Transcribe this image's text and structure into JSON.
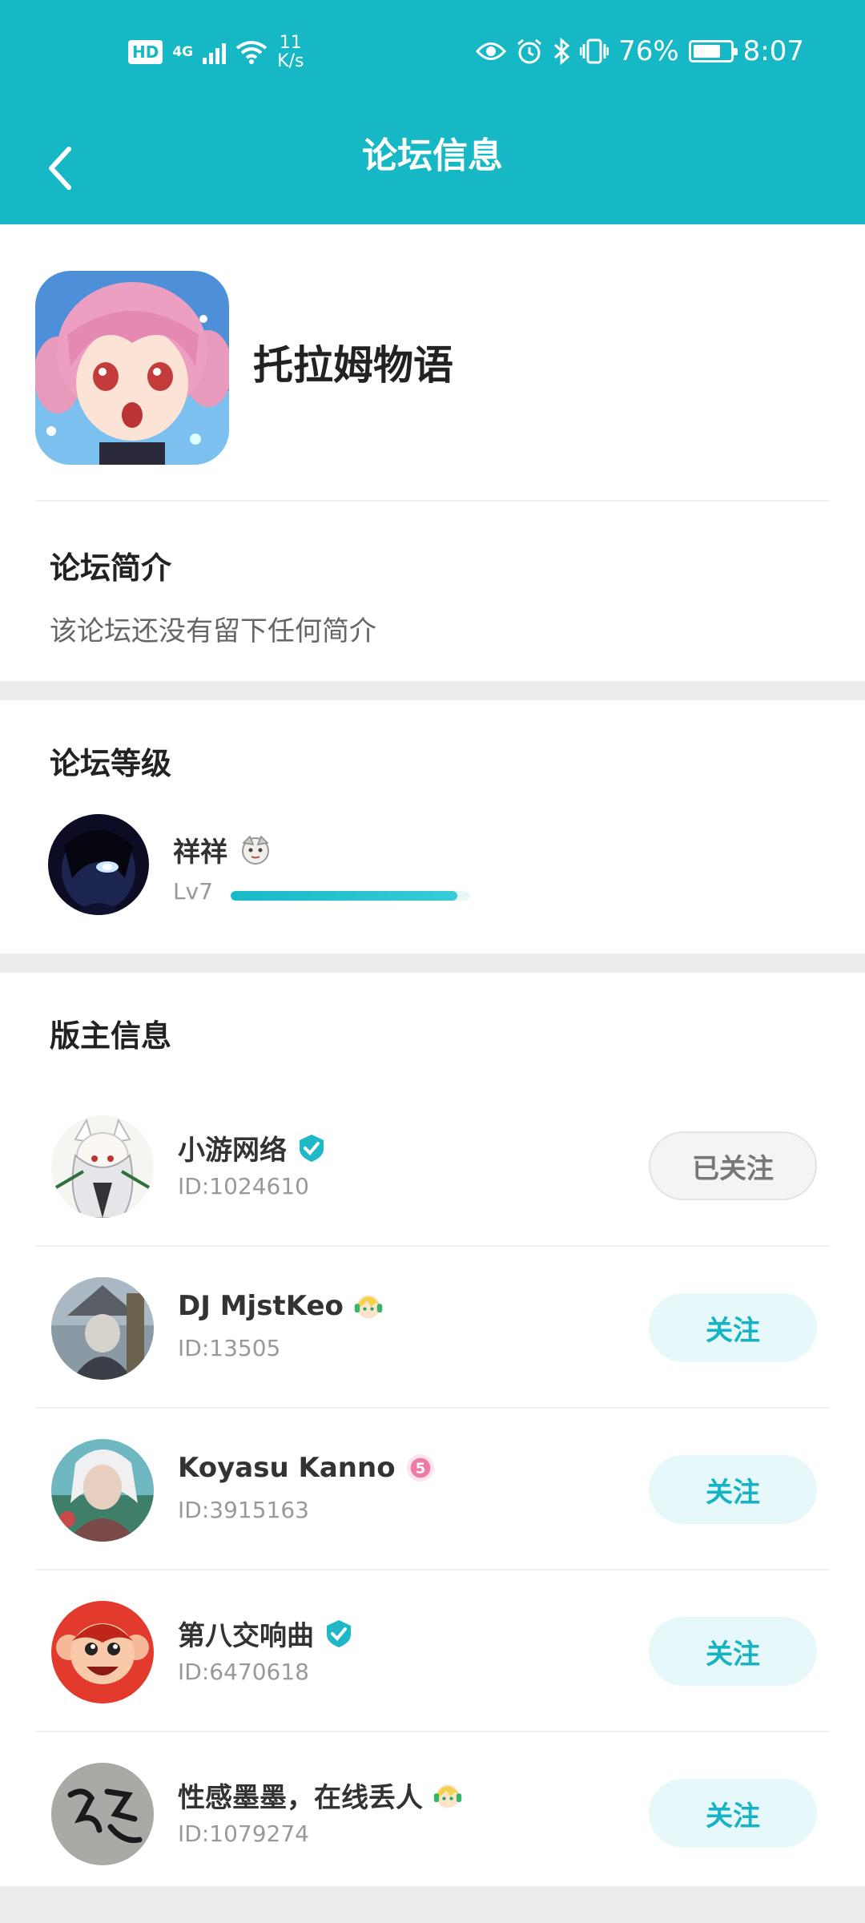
{
  "status_bar": {
    "hd": "HD",
    "network": "4G",
    "speed_value": "11",
    "speed_unit": "K/s",
    "battery": "76%",
    "time": "8:07",
    "icons": [
      "eye-icon",
      "alarm-icon",
      "bluetooth-icon",
      "vibrate-icon",
      "battery-icon"
    ]
  },
  "header": {
    "title": "论坛信息",
    "back_icon": "chevron-left-icon"
  },
  "forum": {
    "name": "托拉姆物语",
    "intro_title": "论坛简介",
    "intro_text": "该论坛还没有留下任何简介"
  },
  "level": {
    "section_title": "论坛等级",
    "user_name": "祥祥",
    "level_label": "Lv7",
    "progress": 0.95
  },
  "moderators": {
    "section_title": "版主信息",
    "items": [
      {
        "name": "小游网络",
        "id": "ID:1024610",
        "button": "已关注",
        "followed": true,
        "badge": "verified-icon"
      },
      {
        "name": "DJ MjstKeo",
        "id": "ID:13505",
        "button": "关注",
        "followed": false,
        "badge": "avatar-badge-icon"
      },
      {
        "name": "Koyasu Kanno",
        "id": "ID:3915163",
        "button": "关注",
        "followed": false,
        "badge": "level-5-badge-icon"
      },
      {
        "name": "第八交响曲",
        "id": "ID:6470618",
        "button": "关注",
        "followed": false,
        "badge": "verified-icon"
      },
      {
        "name": "性感墨墨，在线丢人",
        "id": "ID:1079274",
        "button": "关注",
        "followed": false,
        "badge": "avatar-badge-icon"
      }
    ]
  },
  "colors": {
    "accent": "#16b8c6",
    "follow_bg": "#e6f8fa",
    "followed_bg": "#f4f4f4"
  }
}
